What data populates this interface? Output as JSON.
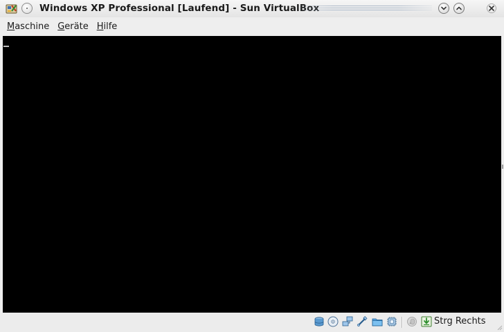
{
  "window": {
    "title": "Windows XP Professional [Laufend] - Sun VirtualBox",
    "controls": [
      "minimize-icon",
      "maximize-icon",
      "close-icon"
    ]
  },
  "menubar": {
    "items": [
      {
        "mnemonic": "M",
        "rest": "aschine"
      },
      {
        "mnemonic": "G",
        "rest": "eräte"
      },
      {
        "mnemonic": "H",
        "rest": "ilfe"
      }
    ]
  },
  "display": {
    "background": "#000000",
    "cursor": "_"
  },
  "statusbar": {
    "indicators": [
      "hard-disk-icon",
      "cd-dvd-icon",
      "network-icon",
      "usb-icon",
      "shared-folder-icon",
      "virtualization-icon",
      "mouse-integration-icon",
      "host-key-icon"
    ],
    "host_key_label": "Strg Rechts"
  }
}
